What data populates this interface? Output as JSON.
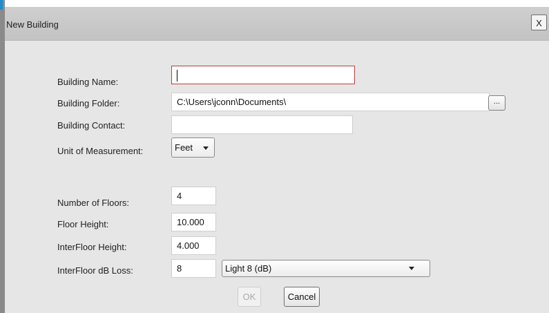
{
  "dialog": {
    "title": "New Building",
    "close_label": "X"
  },
  "form": {
    "building_name": {
      "label": "Building Name:",
      "value": ""
    },
    "building_folder": {
      "label": "Building Folder:",
      "value": "C:\\Users\\jconn\\Documents\\",
      "browse_label": "..."
    },
    "building_contact": {
      "label": "Building Contact:",
      "value": ""
    },
    "unit": {
      "label": "Unit of Measurement:",
      "value": "Feet"
    },
    "floors": {
      "label": "Number of Floors:",
      "value": "4"
    },
    "floor_height": {
      "label": "Floor Height:",
      "value": "10.000"
    },
    "interfloor_height": {
      "label": "InterFloor Height:",
      "value": "4.000"
    },
    "interfloor_loss": {
      "label": "InterFloor dB Loss:",
      "value": "8",
      "preset": "Light 8 (dB)"
    }
  },
  "buttons": {
    "ok": "OK",
    "cancel": "Cancel"
  },
  "colors": {
    "focus_border": "#c23a3a",
    "accent": "#1b8fd6",
    "dialog_bg": "#e6e6e6"
  }
}
